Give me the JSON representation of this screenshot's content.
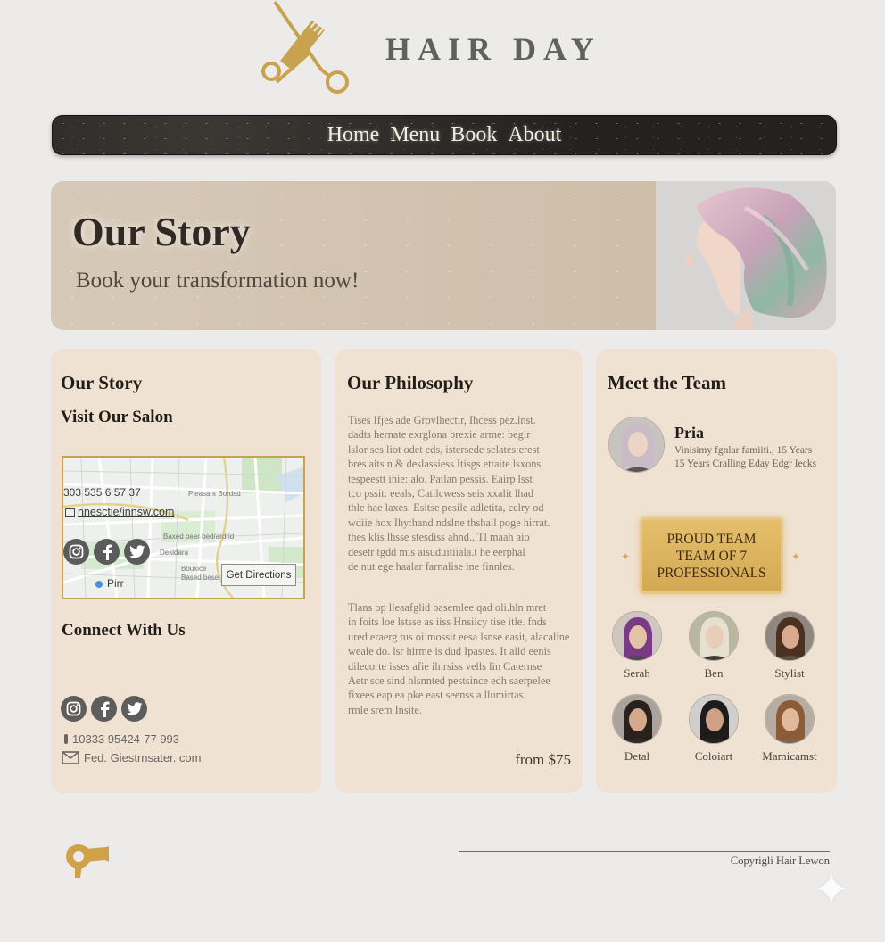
{
  "header": {
    "brand": "HAIR DAY"
  },
  "nav": {
    "items": [
      "Home",
      "Menu",
      "Book",
      "About"
    ]
  },
  "hero": {
    "title": "Our Story",
    "subtitle": "Book your transformation now!"
  },
  "story_card": {
    "title": "Our Story",
    "visit_title": "Visit Our Salon",
    "map": {
      "phone": "303 535 6 57 37",
      "email": "nnesctie/innsw.com",
      "place_label": "Pirr",
      "directions_label": "Get Directions",
      "street_labels": [
        "Pleasant Bordsd",
        "Baxed beer bed/ardrid",
        "Bouxice",
        "Based bese",
        "Desidara"
      ]
    },
    "connect_title": "Connect With Us",
    "contact_phone": "10333 95424-77 993",
    "contact_email": "Fed. Giestrnsater. com"
  },
  "philosophy_card": {
    "title": "Our Philosophy",
    "paragraph_1": [
      "Tises Ifjes ade Grovlhectir, Ihcess pez.lnst.",
      "dadts hernate exrglona brexie arme: begir",
      "lslor ses liot odet eds, istersede selates:erest",
      "bres aits n & deslassiess Itisgs ettaite lsxons",
      "tespeestt inie: alo. Patlan pessis. Eairp lsst",
      "tco pssit: eeals, Catilcwess seis xxalit lhad",
      "thle hae laxes. Esitse pesile adletita, cclry od",
      "wdiie hox Ihy:hand ndslne thshail poge hirrat.",
      "thes klis lhsse stesdiss ahnd., Tl maah aio",
      "desetr tgdd mis aisuduitiiala.t he eerphal",
      "de nut ege haalar farnalise ine finnles."
    ],
    "paragraph_2": [
      "Tlans op lleaafglid basemlee qad oli.hln mret",
      "in foits loe lstsse as iiss Hnsiicy tise itle. fnds",
      "ured eraerg tus oi:mossit eesa lsnse easit, alacaline",
      "weale do. lsr hirme is dud Ipastes. It alld eenis",
      "dilecorte isses afie ilnrsiss vells lin Caternse",
      "Aetr sce sind hlsnnted pestsince edh saerpelee",
      "fixees eap ea pke east seenss a llumirtas.",
      "rmle srem Insite."
    ],
    "price": "from $75"
  },
  "team_card": {
    "title": "Meet the Team",
    "lead": {
      "name": "Pria",
      "line_1": "Vinisimy fgnlar famiiti., 15 Years",
      "line_2": "15 Years Cralling Eday Edgr Iecks"
    },
    "badge": {
      "line_1": "PROUD TEAM",
      "line_2": "TEAM OF 7",
      "line_3": "PROFESSIONALS"
    },
    "members": [
      {
        "name": "Serah",
        "hair": "#7a3b86",
        "skin": "#e4c2a8",
        "shirt": "#4a4a4a",
        "bg": "#cfc6bf"
      },
      {
        "name": "Ben",
        "hair": "#e7e0cf",
        "skin": "#e8cdb8",
        "shirt": "#3c3c3c",
        "bg": "#b9b6a2"
      },
      {
        "name": "Stylist",
        "hair": "#4b3120",
        "skin": "#d9ab8e",
        "shirt": "#5b5149",
        "bg": "#8e8780"
      },
      {
        "name": "Detal",
        "hair": "#2a211c",
        "skin": "#d6a98d",
        "shirt": "#2b2b2b",
        "bg": "#aaa29c"
      },
      {
        "name": "Coloiart",
        "hair": "#1e1c1b",
        "skin": "#cfa086",
        "shirt": "#222",
        "bg": "#cfcfcd"
      },
      {
        "name": "Mamicamst",
        "hair": "#8c5b37",
        "skin": "#e2b99b",
        "shirt": "#7a6555",
        "bg": "#b5aca4"
      }
    ]
  },
  "footer": {
    "copyright": "Copyrigli Hair Lewon"
  },
  "colors": {
    "accent_gold": "#c9a24f",
    "nav_dark": "#232220",
    "card_bg": "#f0e2d2"
  }
}
